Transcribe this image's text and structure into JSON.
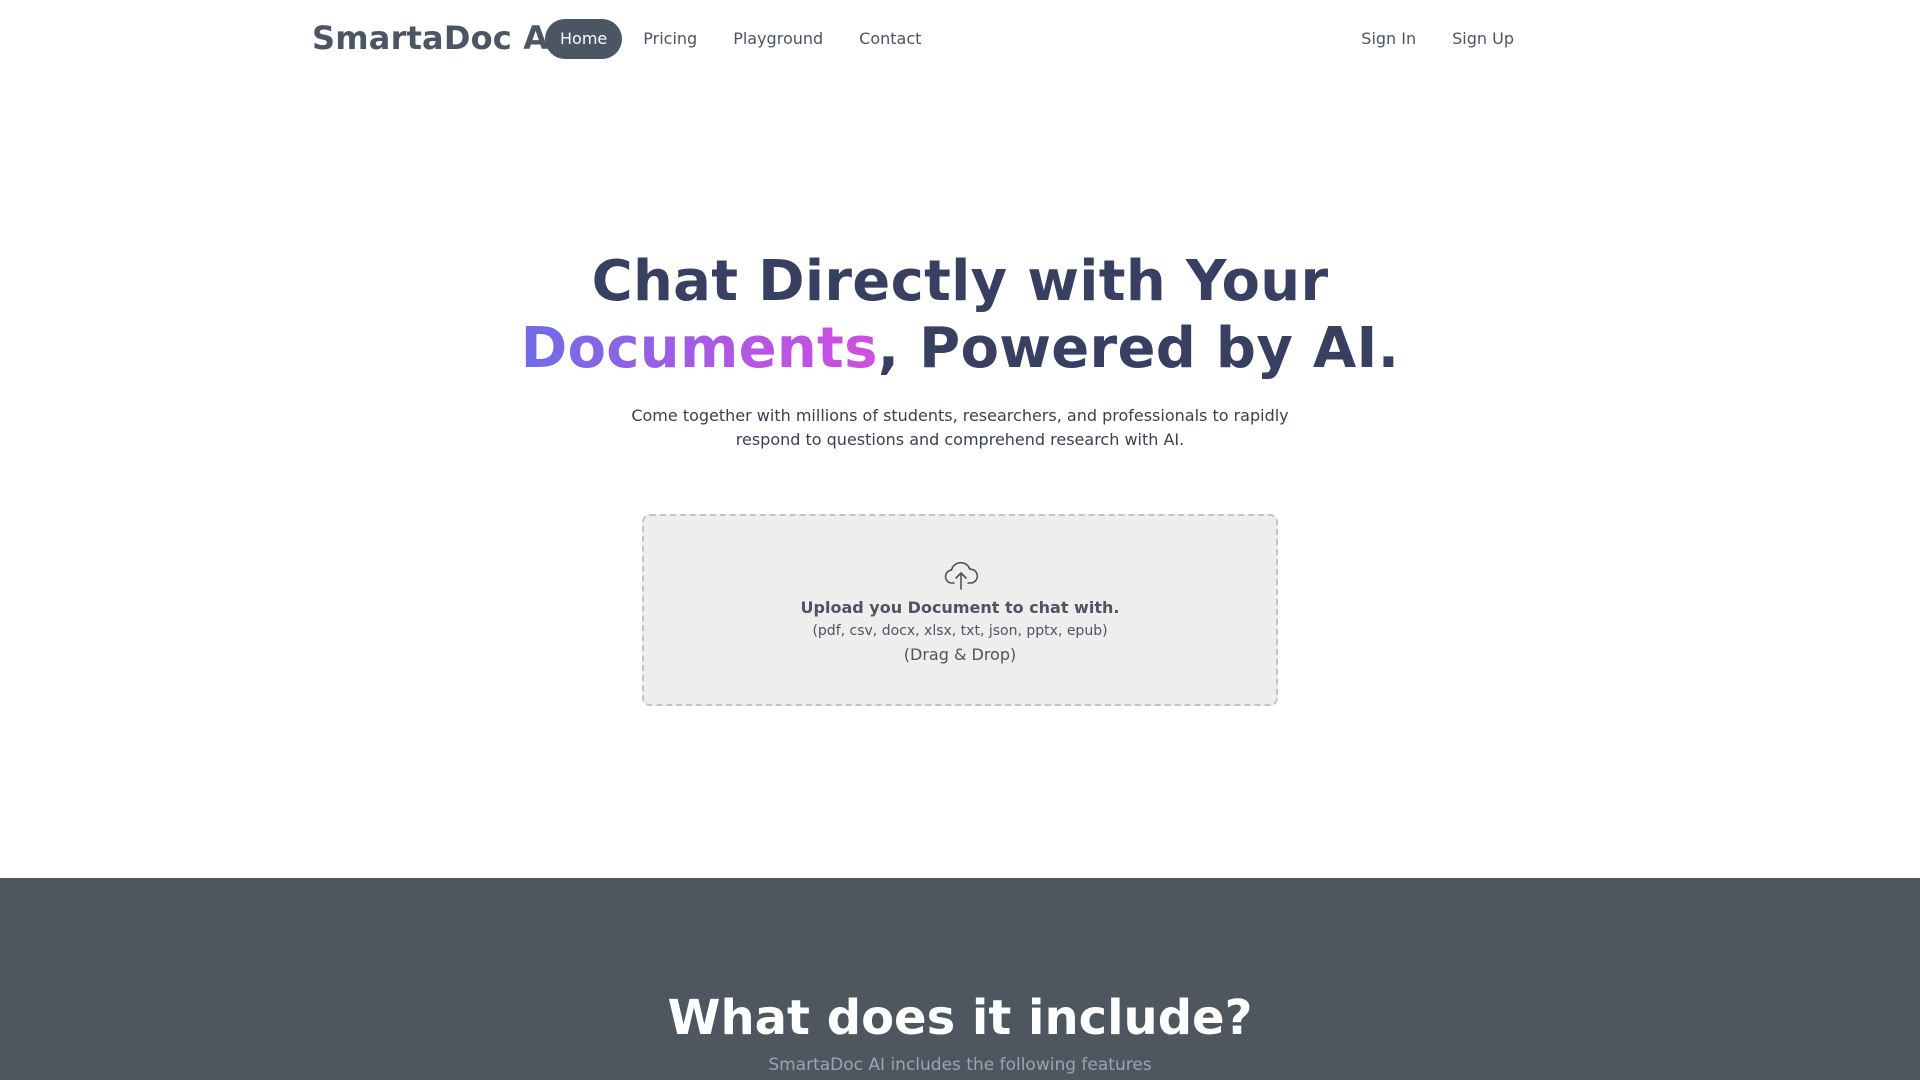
{
  "brand": {
    "name": "SmartaDoc AI"
  },
  "nav": {
    "items": [
      {
        "label": "Home",
        "active": true
      },
      {
        "label": "Pricing",
        "active": false
      },
      {
        "label": "Playground",
        "active": false
      },
      {
        "label": "Contact",
        "active": false
      }
    ],
    "auth": {
      "sign_in": "Sign In",
      "sign_up": "Sign Up"
    }
  },
  "hero": {
    "title_line1": "Chat Directly with Your",
    "title_highlight": "Documents",
    "title_rest": ", Powered by AI.",
    "subtitle": "Come together with millions of students, researchers, and professionals to rapidly respond to questions and comprehend research with AI."
  },
  "upload": {
    "icon": "cloud-upload-icon",
    "title": "Upload you Document to chat with.",
    "types": "(pdf, csv, docx, xlsx, txt, json, pptx, epub)",
    "hint": "(Drag & Drop)"
  },
  "features": {
    "title": "What does it include?",
    "subtitle": "SmartaDoc AI includes the following features"
  },
  "colors": {
    "nav_active_bg": "#4b5563",
    "highlight_gradient_start": "#6e6de6",
    "highlight_gradient_end": "#d24de0",
    "features_bg": "#4e5760"
  }
}
